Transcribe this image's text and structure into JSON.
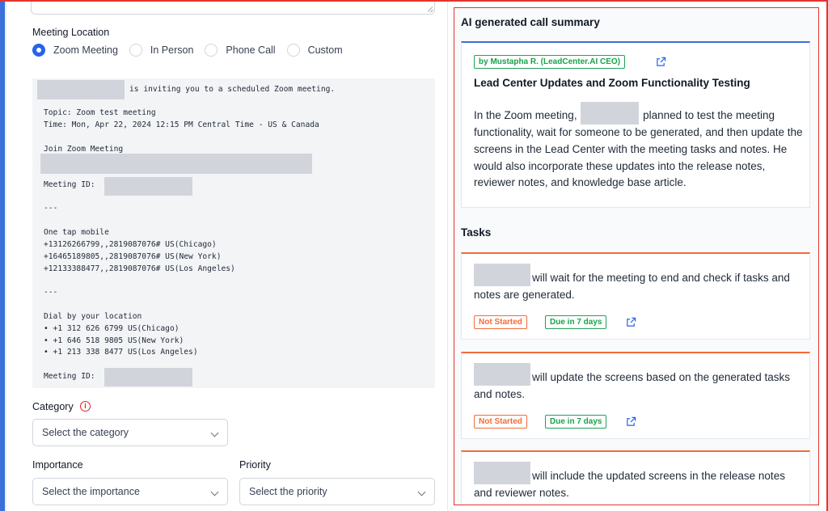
{
  "form": {
    "meeting_location_label": "Meeting Location",
    "location_options": [
      {
        "label": "Zoom Meeting",
        "checked": true
      },
      {
        "label": "In Person",
        "checked": false
      },
      {
        "label": "Phone Call",
        "checked": false
      },
      {
        "label": "Custom",
        "checked": false
      }
    ],
    "invite": {
      "line_inviting": "is inviting you to a scheduled Zoom meeting.",
      "topic": "Topic: Zoom test meeting",
      "time": "Time: Mon, Apr 22, 2024 12:15 PM Central Time - US & Canada",
      "join": "Join Zoom Meeting",
      "meeting_id": "Meeting ID:",
      "sep1": "---",
      "one_tap": "One tap mobile",
      "tap1": "+13126266799,,2819087076# US(Chicago)",
      "tap2": "+16465189805,,2819087076# US(New York)",
      "tap3": "+12133388477,,2819087076# US(Los Angeles)",
      "sep2": "---",
      "dial": "Dial by your location",
      "dial1": "• +1 312 626 6799 US(Chicago)",
      "dial2": "• +1 646 518 9805 US(New York)",
      "dial3": "• +1 213 338 8477 US(Los Angeles)",
      "meeting_id2": "Meeting ID:"
    },
    "category_label": "Category",
    "category_info_icon": "i",
    "category_placeholder": "Select the category",
    "importance_label": "Importance",
    "importance_placeholder": "Select the importance",
    "priority_label": "Priority",
    "priority_placeholder": "Select the priority"
  },
  "summary_panel": {
    "title": "AI generated call summary",
    "author_badge": "by Mustapha R. (LeadCenter.AI CEO)",
    "card_title": "Lead Center Updates and Zoom Functionality Testing",
    "text_before": "In the Zoom meeting,",
    "text_after": "planned to test the meeting functionality, wait for someone to be generated, and then update the screens in the Lead Center with the meeting tasks and notes. He would also incorporate these updates into the release notes, reviewer notes, and knowledge base article.",
    "tasks_title": "Tasks",
    "tasks": [
      {
        "text": "will wait for the meeting to end and check if tasks and notes are generated.",
        "status": "Not Started",
        "due": "Due in 7 days"
      },
      {
        "text": "will update the screens based on the generated tasks and notes.",
        "status": "Not Started",
        "due": "Due in 7 days"
      },
      {
        "text": "will include the updated screens in the release notes and reviewer notes."
      }
    ]
  },
  "colors": {
    "accent": "#2563eb",
    "status_orange": "#f26b3a",
    "status_green": "#16a34a",
    "frame_red": "#e3342f"
  }
}
